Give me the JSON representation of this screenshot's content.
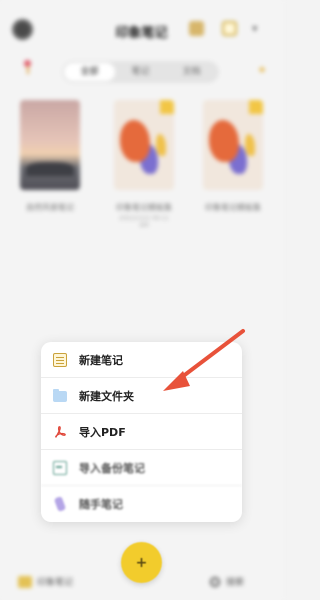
{
  "header": {
    "title": "印象笔记",
    "more_icon": "▾"
  },
  "segments": [
    {
      "label": "全部",
      "active": true
    },
    {
      "label": "笔记",
      "active": false
    },
    {
      "label": "文档",
      "active": false
    }
  ],
  "notes": [
    {
      "caption": "自然风景笔记",
      "date": "",
      "cover": "sunset"
    },
    {
      "caption": "印象笔记模板集",
      "date": "2022/12/2 09:11 AM",
      "cover": "colorful"
    },
    {
      "caption": "印象笔记模板集",
      "date": "",
      "cover": "colorful"
    }
  ],
  "menu": {
    "items": [
      {
        "label": "新建笔记",
        "icon": "note-icon",
        "dim": false
      },
      {
        "label": "新建文件夹",
        "icon": "folder-icon",
        "dim": false
      },
      {
        "label": "导入PDF",
        "icon": "pdf-icon",
        "dim": false
      },
      {
        "label": "导入备份笔记",
        "icon": "import-icon",
        "dim": true
      },
      {
        "label": "随手笔记",
        "icon": "pen-icon",
        "dim": true
      }
    ]
  },
  "fab": {
    "symbol": "+"
  },
  "bottom_bar": {
    "left_label": "印象笔记",
    "right_label": "搜索"
  },
  "colors": {
    "accent": "#f2cc2c",
    "arrow": "#e8523a",
    "pdf_red": "#e0473a"
  }
}
